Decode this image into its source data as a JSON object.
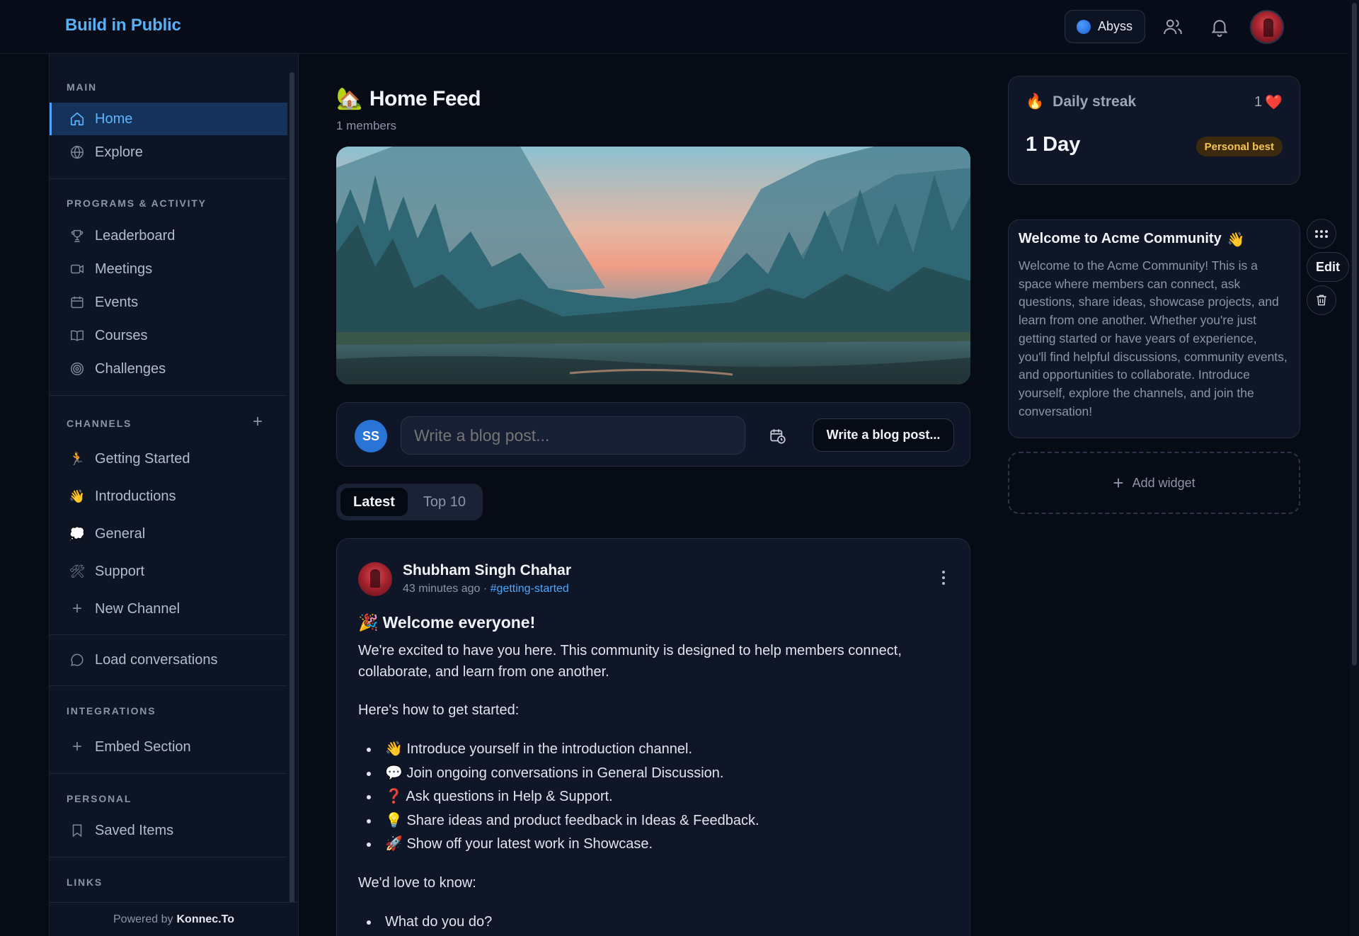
{
  "topbar": {
    "brand": "Build in Public",
    "workspace": "Abyss",
    "icons": [
      "members-icon",
      "bell-icon"
    ]
  },
  "sidebar": {
    "sections": {
      "main": "MAIN",
      "programs": "PROGRAMS & ACTIVITY",
      "channels": "CHANNELS",
      "integrations": "INTEGRATIONS",
      "personal": "PERSONAL",
      "links": "LINKS"
    },
    "main_items": [
      {
        "label": "Home",
        "icon": "home-icon"
      },
      {
        "label": "Explore",
        "icon": "globe-icon"
      }
    ],
    "program_items": [
      {
        "label": "Leaderboard",
        "icon": "trophy-icon"
      },
      {
        "label": "Meetings",
        "icon": "video-icon"
      },
      {
        "label": "Events",
        "icon": "calendar-icon"
      },
      {
        "label": "Courses",
        "icon": "book-icon"
      },
      {
        "label": "Challenges",
        "icon": "target-icon"
      }
    ],
    "channel_items": [
      {
        "label": "Getting Started",
        "emoji": "🏃"
      },
      {
        "label": "Introductions",
        "emoji": "👋"
      },
      {
        "label": "General",
        "emoji": "💭"
      },
      {
        "label": "Support",
        "emoji": "🛠"
      },
      {
        "label": "New Channel",
        "emoji": "+"
      }
    ],
    "load_conversations": "Load conversations",
    "embed_section": "Embed Section",
    "saved_items": "Saved Items",
    "footer_prefix": "Powered by",
    "footer_brand": "Konnec.To"
  },
  "main": {
    "title_emoji": "🏡",
    "title": "Home Feed",
    "subtitle": "1 members",
    "composer": {
      "avatar_initials": "SS",
      "placeholder": "Write a blog post...",
      "button": "Write a blog post..."
    },
    "tabs": [
      "Latest",
      "Top 10"
    ],
    "post": {
      "author": "Shubham Singh Chahar",
      "time": "43 minutes ago",
      "separator": "·",
      "channel_tag": "#getting-started",
      "title_emoji": "🎉",
      "title": "Welcome everyone!",
      "intro": "We're excited to have you here. This community is designed to help members connect, collaborate, and learn from one another.",
      "how_to": "Here's how to get started:",
      "steps": [
        "👋 Introduce yourself in the introduction channel.",
        "💬 Join ongoing conversations in General Discussion.",
        "❓ Ask questions in Help & Support.",
        "💡 Share ideas and product feedback in Ideas & Feedback.",
        "🚀 Show off your latest work in Showcase."
      ],
      "love_to_know": "We'd love to know:",
      "questions": [
        "What do you do?"
      ]
    }
  },
  "widgets": {
    "streak": {
      "emoji": "🔥",
      "label": "Daily streak",
      "count": "1",
      "heart": "❤️",
      "days": "1 Day",
      "badge": "Personal best"
    },
    "welcome": {
      "title": "Welcome to Acme Community",
      "emoji": "👋",
      "description": "Welcome to the Acme Community! This is a space where members can connect, ask questions, share ideas, showcase projects, and learn from one another. Whether you're just getting started or have years of experience, you'll find helpful discussions, community events, and opportunities to collaborate. Introduce yourself, explore the channels, and join the conversation!"
    },
    "edit_label": "Edit",
    "add_widget": "Add widget"
  }
}
